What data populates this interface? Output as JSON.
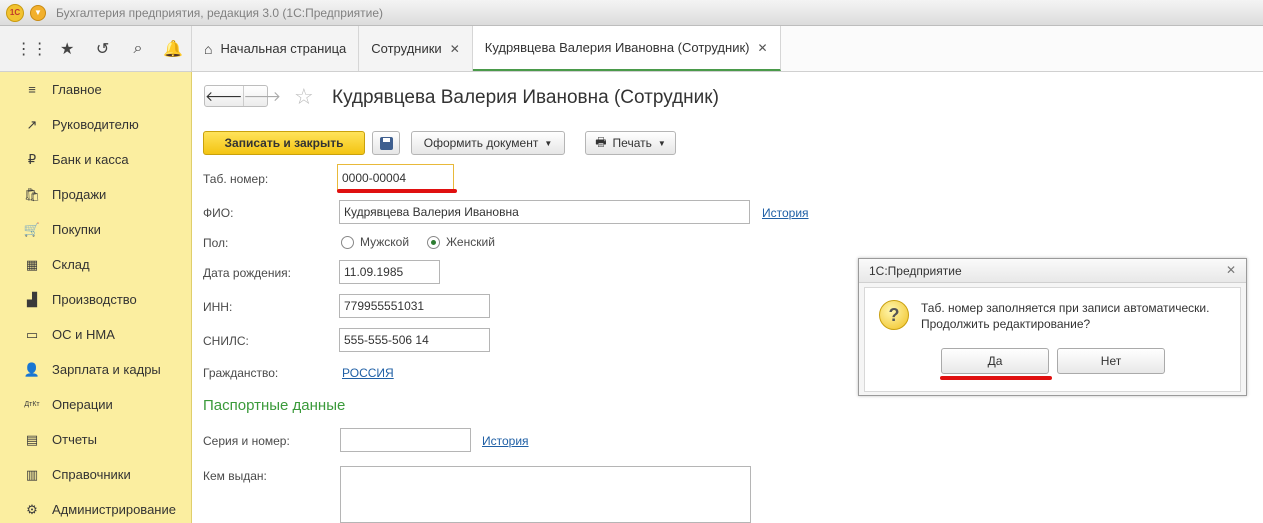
{
  "window": {
    "title": "Бухгалтерия предприятия, редакция 3.0  (1С:Предприятие)",
    "logo": "1С"
  },
  "topnav": {
    "icons": [
      "apps-grid-icon",
      "star-icon",
      "history-icon",
      "search-icon",
      "bell-icon"
    ],
    "tabs": [
      {
        "label": "Начальная страница",
        "closable": false
      },
      {
        "label": "Сотрудники",
        "closable": true
      },
      {
        "label": "Кудрявцева Валерия Ивановна (Сотрудник)",
        "closable": true
      }
    ]
  },
  "sidebar": {
    "items": [
      {
        "label": "Главное",
        "icon": "≡"
      },
      {
        "label": "Руководителю",
        "icon": "↗"
      },
      {
        "label": "Банк и касса",
        "icon": "₽"
      },
      {
        "label": "Продажи",
        "icon": "🛍"
      },
      {
        "label": "Покупки",
        "icon": "🛒"
      },
      {
        "label": "Склад",
        "icon": "▦"
      },
      {
        "label": "Производство",
        "icon": "▟"
      },
      {
        "label": "ОС и НМА",
        "icon": "▭"
      },
      {
        "label": "Зарплата и кадры",
        "icon": "👤"
      },
      {
        "label": "Операции",
        "icon": "ДтКт"
      },
      {
        "label": "Отчеты",
        "icon": "▤"
      },
      {
        "label": "Справочники",
        "icon": "▥"
      },
      {
        "label": "Администрирование",
        "icon": "⚙"
      }
    ]
  },
  "form": {
    "title": "Кудрявцева Валерия Ивановна (Сотрудник)",
    "toolbar": {
      "save_close": "Записать и закрыть",
      "create_doc": "Оформить документ",
      "print": "Печать"
    },
    "tab_number": {
      "label": "Таб. номер:",
      "value": "0000-00004"
    },
    "fio": {
      "label": "ФИО:",
      "value": "Кудрявцева Валерия Ивановна",
      "link": "История"
    },
    "gender": {
      "label": "Пол:",
      "male": "Мужской",
      "female": "Женский",
      "selected": "female"
    },
    "birth_date": {
      "label": "Дата рождения:",
      "value": "11.09.1985"
    },
    "inn": {
      "label": "ИНН:",
      "value": "779955551031"
    },
    "snils": {
      "label": "СНИЛС:",
      "value": "555-555-506 14"
    },
    "citizenship": {
      "label": "Гражданство:",
      "value": "РОССИЯ"
    },
    "passport_section": "Паспортные данные",
    "series_number": {
      "label": "Серия и номер:",
      "value": "",
      "link": "История"
    },
    "issued_by": {
      "label": "Кем выдан:",
      "value": ""
    }
  },
  "dialog": {
    "title": "1С:Предприятие",
    "message_line1": "Таб. номер заполняется при записи автоматически.",
    "message_line2": "Продолжить редактирование?",
    "yes": "Да",
    "no": "Нет"
  },
  "colors": {
    "sidebar_bg": "#fbeea0",
    "primary_button": "#f3c412",
    "accent_green": "#3a9a3a",
    "link": "#1f5fa5",
    "highlight_red": "#e01010"
  }
}
